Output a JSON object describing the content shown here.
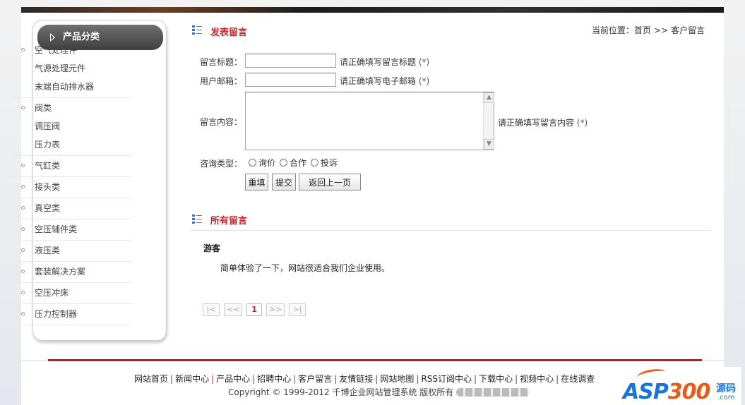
{
  "sidebar": {
    "title": "产品分类",
    "groups": [
      {
        "cat": "空气处理件",
        "subs": [
          "气源处理元件",
          "末端自动排水器"
        ]
      },
      {
        "cat": "阀类",
        "subs": [
          "调压阀",
          "压力表"
        ]
      },
      {
        "cat": "气缸类",
        "subs": []
      },
      {
        "cat": "接头类",
        "subs": []
      },
      {
        "cat": "真空类",
        "subs": []
      },
      {
        "cat": "空压辅件类",
        "subs": []
      },
      {
        "cat": "液压类",
        "subs": []
      },
      {
        "cat": "套装解决方案",
        "subs": []
      },
      {
        "cat": "空压冲床",
        "subs": []
      },
      {
        "cat": "压力控制器",
        "subs": []
      }
    ]
  },
  "breadcrumb": {
    "prefix": "当前位置：",
    "home": "首页",
    "sep": ">>",
    "current": "客户留言"
  },
  "form": {
    "section_title": "发表留言",
    "title_label": "留言标题：",
    "title_value": "",
    "title_hint": "请正确填写留言标题",
    "email_label": "用户邮箱：",
    "email_value": "",
    "email_hint": "请正确填写电子邮箱",
    "content_label": "留言内容：",
    "content_value": "",
    "content_hint": "请正确填写留言内容",
    "required_mark": "(*)",
    "type_label": "咨询类型：",
    "types": [
      "询价",
      "合作",
      "投诉"
    ],
    "reset_label": "重填",
    "submit_label": "提交",
    "back_label": "返回上一页"
  },
  "messages": {
    "section_title": "所有留言",
    "items": [
      {
        "author": "游客",
        "text": "简单体验了一下，网站很适合我们企业使用。"
      }
    ]
  },
  "pager": {
    "first": "|<",
    "prev": "<<",
    "current": "1",
    "next": ">>",
    "last": ">|"
  },
  "footer": {
    "links": [
      "网站首页",
      "新闻中心",
      "产品中心",
      "招聘中心",
      "客户留言",
      "友情链接",
      "网站地图",
      "RSS订阅中心",
      "下载中心",
      "视频中心",
      "在线调查"
    ],
    "copyright": "Copyright © 1999-2012 千博企业网站管理系统 版权所有"
  },
  "logo": {
    "brand_a": "ASP",
    "brand_b": "300",
    "yuan": "源码",
    "com": ".com"
  },
  "colors": {
    "accent": "#c0282d",
    "footer_line": "#c8171c",
    "sidebar_head": "#4a4a4a"
  }
}
